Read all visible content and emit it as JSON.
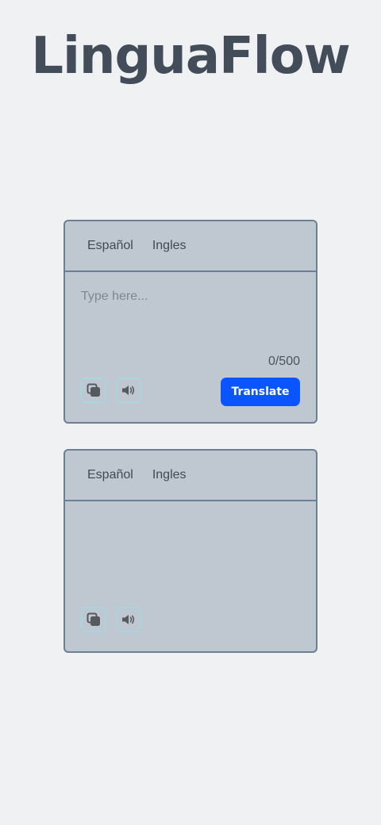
{
  "app": {
    "title": "LinguaFlow"
  },
  "source": {
    "languages": [
      "Español",
      "Ingles"
    ],
    "placeholder": "Type here...",
    "value": "",
    "char_count": "0/500",
    "translate_label": "Translate"
  },
  "target": {
    "languages": [
      "Español",
      "Ingles"
    ],
    "output": ""
  },
  "colors": {
    "background": "#f0f1f3",
    "card": "#bfc7d1",
    "card_border": "#6d7f93",
    "accent": "#0a55ff",
    "icon_border": "#a9d4e0",
    "title": "#434d59"
  },
  "icons": {
    "copy": "copy-icon",
    "speak": "speaker-icon"
  }
}
